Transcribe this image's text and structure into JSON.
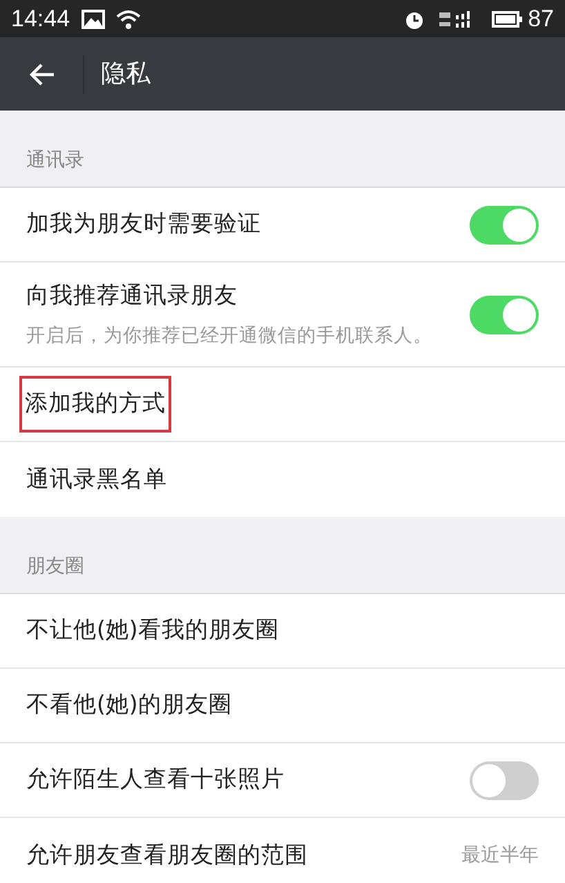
{
  "status_bar": {
    "time": "14:44",
    "battery": "87"
  },
  "nav_bar": {
    "title": "隐私"
  },
  "sections": [
    {
      "header": "通讯录",
      "items": [
        {
          "kind": "toggle",
          "label": "加我为朋友时需要验证",
          "on": true
        },
        {
          "kind": "toggle",
          "label": "向我推荐通讯录朋友",
          "on": true,
          "description": "开启后，为你推荐已经开通微信的手机联系人。"
        },
        {
          "kind": "link",
          "label": "添加我的方式",
          "highlighted": true
        },
        {
          "kind": "link",
          "label": "通讯录黑名单",
          "highlighted": false
        }
      ]
    },
    {
      "header": "朋友圈",
      "items": [
        {
          "kind": "link",
          "label": "不让他(她)看我的朋友圈",
          "highlighted": false
        },
        {
          "kind": "link",
          "label": "不看他(她)的朋友圈",
          "highlighted": false
        },
        {
          "kind": "toggle",
          "label": "允许陌生人查看十张照片",
          "on": false
        },
        {
          "kind": "value",
          "label": "允许朋友查看朋友圈的范围",
          "value": "最近半年"
        }
      ]
    }
  ]
}
